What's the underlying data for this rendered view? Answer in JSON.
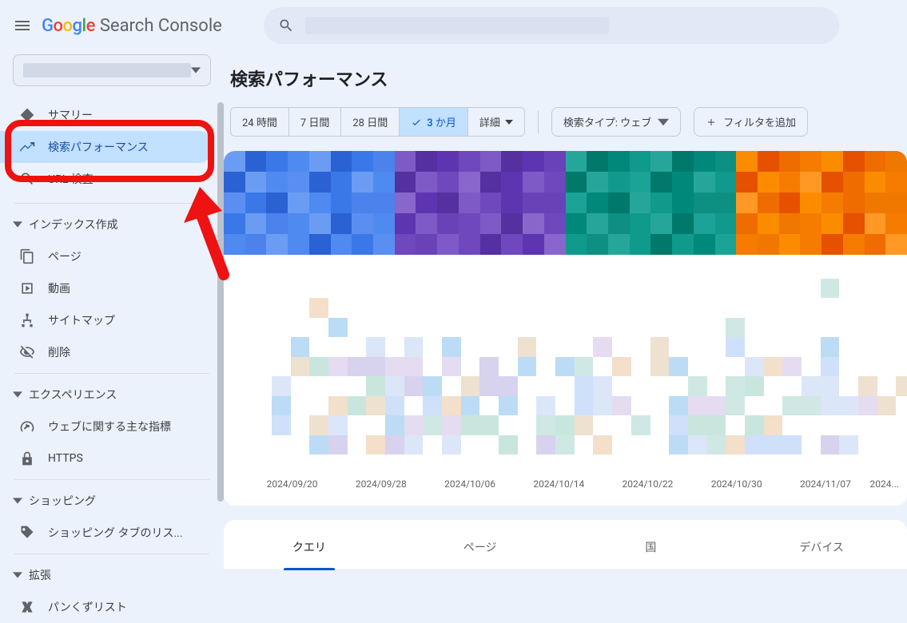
{
  "product": {
    "google": "Google",
    "name": "Search Console"
  },
  "page_title": "検索パフォーマンス",
  "sidebar": {
    "items": {
      "summary": "サマリー",
      "performance": "検索パフォーマンス",
      "url_inspect": "URL 検査"
    },
    "indexing": {
      "header": "インデックス作成",
      "pages": "ページ",
      "videos": "動画",
      "sitemaps": "サイトマップ",
      "removals": "削除"
    },
    "experience": {
      "header": "エクスペリエンス",
      "cwv": "ウェブに関する主な指標",
      "https": "HTTPS"
    },
    "shopping": {
      "header": "ショッピング",
      "listing": "ショッピング タブのリス..."
    },
    "enhancements": {
      "header": "拡張",
      "breadcrumb": "パンくずリスト"
    }
  },
  "filters": {
    "range": {
      "h24": "24 時間",
      "d7": "7 日間",
      "d28": "28 日間",
      "m3": "3 か月",
      "detail": "詳細"
    },
    "search_type": "検索タイプ: ウェブ",
    "add_filter": "フィルタを追加"
  },
  "chart_data": {
    "type": "line",
    "note": "metric values and series are pixelated/redacted in the source image",
    "metric_colors": [
      "#4285F4",
      "#5e35b1",
      "#00897b",
      "#ef6c00"
    ],
    "x_ticks": [
      "2024/09/20",
      "2024/09/28",
      "2024/10/06",
      "2024/10/14",
      "2024/10/22",
      "2024/10/30",
      "2024/11/07",
      "2024..."
    ]
  },
  "tabs": {
    "query": "クエリ",
    "page": "ページ",
    "country": "国",
    "device": "デバイス"
  }
}
